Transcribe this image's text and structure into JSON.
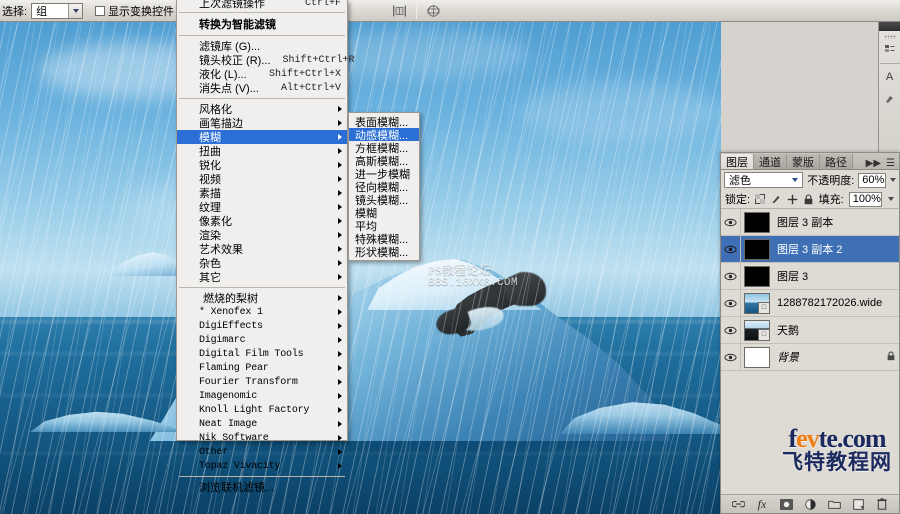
{
  "options_bar": {
    "select_label": "选择:",
    "select_value": "组",
    "show_transform_label": "显示变换控件",
    "show_transform_checked": false,
    "align_icons": [
      "align-left-edges-icon",
      "align-horizontal-centers-icon",
      "align-right-edges-icon",
      "distribute-horizontal-icon",
      "distribute-centers-icon"
    ]
  },
  "canvas": {
    "watermark_line1": "PS教程论坛",
    "watermark_line2": "BBS.16XX8.COM",
    "scene": "polar-bear-on-iceberg-in-rain"
  },
  "filter_menu": {
    "top_items": [
      {
        "label": "上次滤镜操作",
        "shortcut": "Ctrl+F",
        "arrow": false
      },
      {
        "label": "转换为智能滤镜",
        "shortcut": "",
        "arrow": false,
        "bold": true
      }
    ],
    "dialog_items": [
      {
        "label": "滤镜库 (G)...",
        "shortcut": "",
        "arrow": false
      },
      {
        "label": "镜头校正 (R)...",
        "shortcut": "Shift+Ctrl+R",
        "arrow": false
      },
      {
        "label": "液化 (L)...",
        "shortcut": "Shift+Ctrl+X",
        "arrow": false
      },
      {
        "label": "消失点 (V)...",
        "shortcut": "Alt+Ctrl+V",
        "arrow": false
      }
    ],
    "categories": [
      {
        "label": "风格化",
        "arrow": true,
        "selected": false
      },
      {
        "label": "画笔描边",
        "arrow": true,
        "selected": false
      },
      {
        "label": "模糊",
        "arrow": true,
        "selected": true
      },
      {
        "label": "扭曲",
        "arrow": true,
        "selected": false
      },
      {
        "label": "锐化",
        "arrow": true,
        "selected": false
      },
      {
        "label": "视频",
        "arrow": true,
        "selected": false
      },
      {
        "label": "素描",
        "arrow": true,
        "selected": false
      },
      {
        "label": "纹理",
        "arrow": true,
        "selected": false
      },
      {
        "label": "像素化",
        "arrow": true,
        "selected": false
      },
      {
        "label": "渲染",
        "arrow": true,
        "selected": false
      },
      {
        "label": "艺术效果",
        "arrow": true,
        "selected": false
      },
      {
        "label": "杂色",
        "arrow": true,
        "selected": false
      },
      {
        "label": "其它",
        "arrow": true,
        "selected": false
      }
    ],
    "plugins": [
      {
        "label": "燃烧的梨树",
        "arrow": true,
        "cn": true
      },
      {
        "label": "* Xenofex 1",
        "arrow": true,
        "cn": false
      },
      {
        "label": "DigiEffects",
        "arrow": true,
        "cn": false
      },
      {
        "label": "Digimarc",
        "arrow": true,
        "cn": false
      },
      {
        "label": "Digital Film Tools",
        "arrow": true,
        "cn": false
      },
      {
        "label": "Flaming Pear",
        "arrow": true,
        "cn": false
      },
      {
        "label": "Fourier Transform",
        "arrow": true,
        "cn": false
      },
      {
        "label": "Imagenomic",
        "arrow": true,
        "cn": false
      },
      {
        "label": "Knoll Light Factory",
        "arrow": true,
        "cn": false
      },
      {
        "label": "Neat Image",
        "arrow": true,
        "cn": false
      },
      {
        "label": "Nik Software",
        "arrow": true,
        "cn": false
      },
      {
        "label": "Other",
        "arrow": true,
        "cn": false
      },
      {
        "label": "Topaz Vivacity",
        "arrow": true,
        "cn": false
      }
    ],
    "footer_item": {
      "label": "浏览联机滤镜...",
      "arrow": false
    }
  },
  "blur_submenu": {
    "items": [
      {
        "label": "表面模糊...",
        "selected": false
      },
      {
        "label": "动感模糊...",
        "selected": true
      },
      {
        "label": "方框模糊...",
        "selected": false
      },
      {
        "label": "高斯模糊...",
        "selected": false
      },
      {
        "label": "进一步模糊",
        "selected": false
      },
      {
        "label": "径向模糊...",
        "selected": false
      },
      {
        "label": "镜头模糊...",
        "selected": false
      },
      {
        "label": "模糊",
        "selected": false
      },
      {
        "label": "平均",
        "selected": false
      },
      {
        "label": "特殊模糊...",
        "selected": false
      },
      {
        "label": "形状模糊...",
        "selected": false
      }
    ]
  },
  "layers_panel": {
    "tabs": [
      {
        "label": "图层",
        "active": true
      },
      {
        "label": "通道",
        "active": false
      },
      {
        "label": "蒙版",
        "active": false
      },
      {
        "label": "路径",
        "active": false
      }
    ],
    "collapse_icon": "collapse-panel-icon",
    "menu_icon": "panel-menu-icon",
    "blend_mode": "滤色",
    "opacity_label": "不透明度:",
    "opacity_value": "60%",
    "lock_label": "锁定:",
    "lock_icons": [
      "lock-transparent-pixels-icon",
      "lock-image-pixels-icon",
      "lock-position-icon",
      "lock-all-icon"
    ],
    "fill_label": "填充:",
    "fill_value": "100%",
    "layers": [
      {
        "name": "图层 3 副本",
        "visible": true,
        "selected": false,
        "thumb": "black",
        "locked": false,
        "italic": false,
        "linked": false
      },
      {
        "name": "图层 3 副本 2",
        "visible": true,
        "selected": true,
        "thumb": "black",
        "locked": false,
        "italic": false,
        "linked": false
      },
      {
        "name": "图层 3",
        "visible": true,
        "selected": false,
        "thumb": "black",
        "locked": false,
        "italic": false,
        "linked": false
      },
      {
        "name": "1288782172026.wide",
        "visible": true,
        "selected": false,
        "thumb": "photo1",
        "locked": false,
        "italic": false,
        "linked": true
      },
      {
        "name": "天鹅",
        "visible": true,
        "selected": false,
        "thumb": "photo2",
        "locked": false,
        "italic": false,
        "linked": true
      },
      {
        "name": "背景",
        "visible": true,
        "selected": false,
        "thumb": "white",
        "locked": true,
        "italic": true,
        "linked": false
      }
    ],
    "footer_buttons": [
      "link-layers-icon",
      "add-layer-style-icon",
      "add-layer-mask-icon",
      "new-adjustment-layer-icon",
      "new-group-icon",
      "new-layer-icon",
      "delete-layer-icon"
    ]
  },
  "right_strip": {
    "icons": [
      "history-icon",
      "character-icon",
      "brush-preset-icon"
    ]
  },
  "branding": {
    "line1_pre": "f",
    "line1_accent": "ev",
    "line1_post": "te.com",
    "line2": "飞特教程网"
  }
}
